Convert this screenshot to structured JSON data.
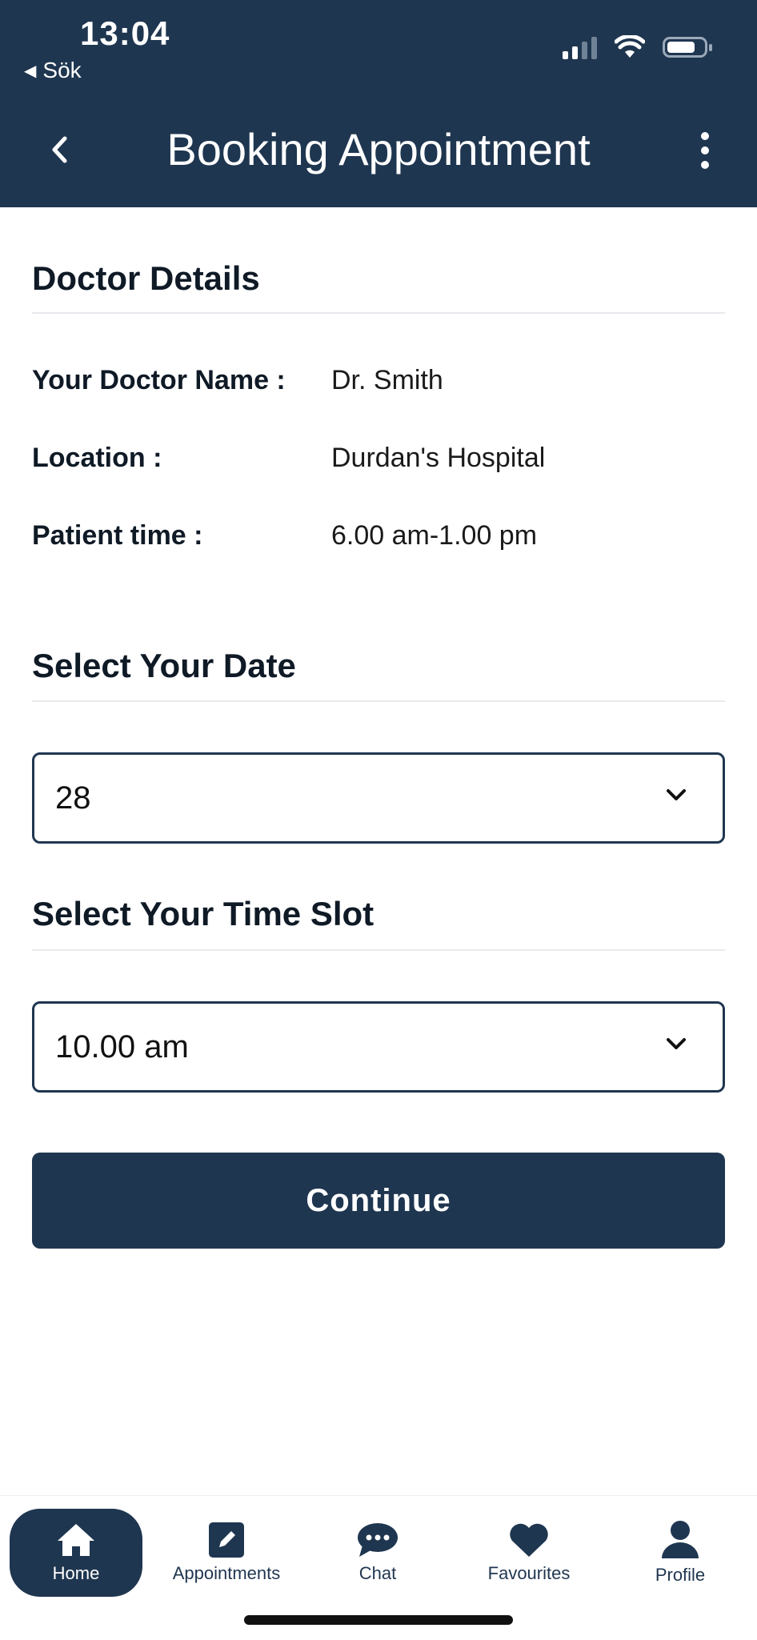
{
  "status_bar": {
    "time": "13:04",
    "back_app_label": "Sök"
  },
  "header": {
    "title": "Booking Appointment",
    "back_icon": "chevron-left-icon",
    "menu_icon": "more-vertical-icon"
  },
  "doctor_details": {
    "title": "Doctor Details",
    "rows": [
      {
        "label": "Your Doctor Name :",
        "value": "Dr. Smith"
      },
      {
        "label": "Location :",
        "value": "Durdan's Hospital"
      },
      {
        "label": "Patient time :",
        "value": "6.00 am-1.00 pm"
      }
    ]
  },
  "date_section": {
    "title": "Select Your Date",
    "selected": "28"
  },
  "time_section": {
    "title": "Select Your Time Slot",
    "selected": "10.00 am"
  },
  "continue_label": "Continue",
  "tabbar": {
    "items": [
      {
        "label": "Home",
        "icon": "home-icon",
        "active": true
      },
      {
        "label": "Appointments",
        "icon": "edit-icon"
      },
      {
        "label": "Chat",
        "icon": "chat-icon"
      },
      {
        "label": "Favourites",
        "icon": "heart-icon"
      },
      {
        "label": "Profile",
        "icon": "profile-icon"
      }
    ]
  },
  "colors": {
    "primary": "#1f3650",
    "background": "#ffffff"
  }
}
